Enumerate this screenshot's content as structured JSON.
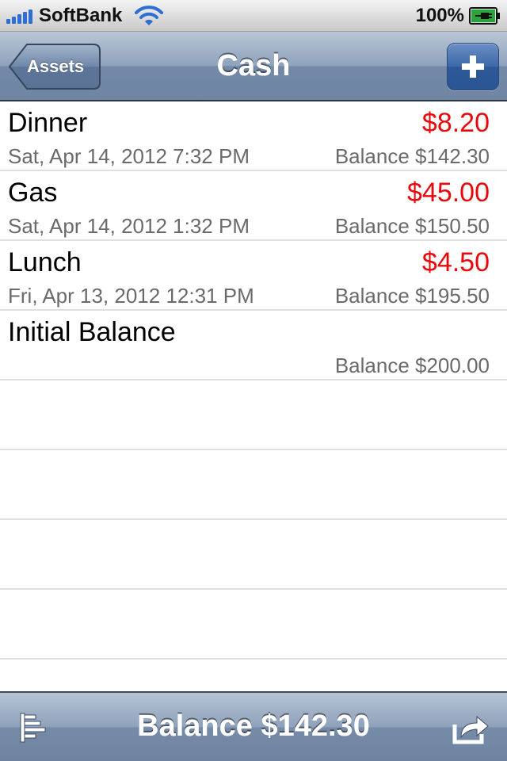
{
  "status_bar": {
    "carrier": "SoftBank",
    "battery_percent": "100%",
    "signal_bars": 5
  },
  "nav": {
    "back_label": "Assets",
    "title": "Cash",
    "add_icon": "plus-icon"
  },
  "transactions": [
    {
      "title": "Dinner",
      "amount": "$8.20",
      "date": "Sat, Apr 14, 2012 7:32 PM",
      "balance": "Balance $142.30"
    },
    {
      "title": "Gas",
      "amount": "$45.00",
      "date": "Sat, Apr 14, 2012 1:32 PM",
      "balance": "Balance $150.50"
    },
    {
      "title": "Lunch",
      "amount": "$4.50",
      "date": "Fri, Apr 13, 2012 12:31 PM",
      "balance": "Balance $195.50"
    },
    {
      "title": "Initial Balance",
      "amount": "",
      "date": "",
      "balance": "Balance $200.00"
    }
  ],
  "toolbar": {
    "balance": "Balance $142.30",
    "left_icon": "list-sort-icon",
    "right_icon": "share-icon"
  },
  "colors": {
    "amount": "#e8090d",
    "secondary_text": "#6a6a6a",
    "signal": "#2f6fd4",
    "battery_plug": "#22b233"
  }
}
